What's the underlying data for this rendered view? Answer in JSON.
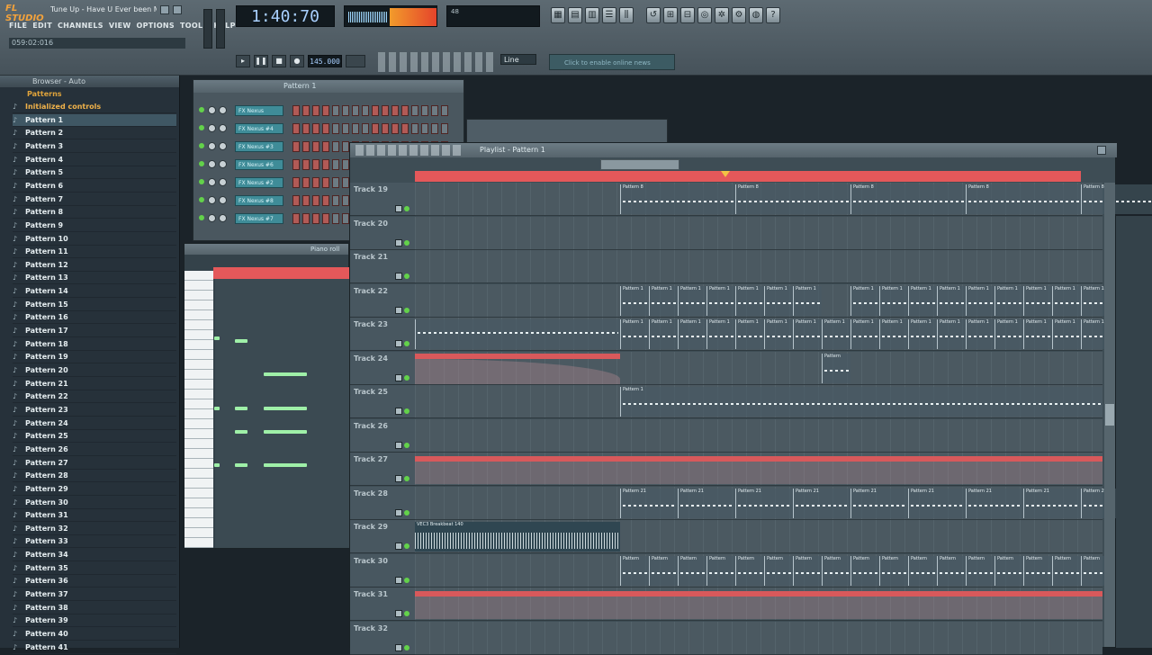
{
  "app": {
    "logo": "FL STUDIO",
    "song_title": "Tune Up - Have U Ever been M...",
    "menu": [
      "FILE",
      "EDIT",
      "CHANNELS",
      "VIEW",
      "OPTIONS",
      "TOOLS",
      "HELP"
    ],
    "hint": "059:02:016",
    "time": "1:40:70",
    "cpu_text": "48",
    "tempo": "145.000",
    "snap": "Line",
    "hint_bar": "Click to enable online news"
  },
  "browser": {
    "title": "Browser - Auto",
    "root": "Patterns",
    "items": [
      "Initialized controls",
      "Pattern 1",
      "Pattern 2",
      "Pattern 3",
      "Pattern 4",
      "Pattern 5",
      "Pattern 6",
      "Pattern 7",
      "Pattern 8",
      "Pattern 9",
      "Pattern 10",
      "Pattern 11",
      "Pattern 12",
      "Pattern 13",
      "Pattern 14",
      "Pattern 15",
      "Pattern 16",
      "Pattern 17",
      "Pattern 18",
      "Pattern 19",
      "Pattern 20",
      "Pattern 21",
      "Pattern 22",
      "Pattern 23",
      "Pattern 24",
      "Pattern 25",
      "Pattern 26",
      "Pattern 27",
      "Pattern 28",
      "Pattern 29",
      "Pattern 30",
      "Pattern 31",
      "Pattern 32",
      "Pattern 33",
      "Pattern 34",
      "Pattern 35",
      "Pattern 36",
      "Pattern 37",
      "Pattern 38",
      "Pattern 39",
      "Pattern 40",
      "Pattern 41"
    ],
    "selected": "Pattern 1"
  },
  "channel_rack": {
    "title": "Pattern 1",
    "channels": [
      "FX Nexus",
      "FX Nexus #4",
      "FX Nexus #3",
      "FX Nexus #6",
      "FX Nexus #2",
      "FX Nexus #8",
      "FX Nexus #7"
    ]
  },
  "piano_roll": {
    "title": "Piano roll"
  },
  "playlist": {
    "title": "Playlist - Pattern 1",
    "tracks": [
      "Track 19",
      "Track 20",
      "Track 21",
      "Track 22",
      "Track 23",
      "Track 24",
      "Track 25",
      "Track 26",
      "Track 27",
      "Track 28",
      "Track 29",
      "Track 30",
      "Track 31",
      "Track 32"
    ],
    "clip_labels": {
      "t19": "Pattern 8",
      "t22": "Pattern 1",
      "t25": "Pattern 1",
      "t28": "Pattern 21",
      "t29": "VEC3 Breakbeat 140",
      "t30": "Pattern",
      "t24": "Pattern"
    }
  }
}
